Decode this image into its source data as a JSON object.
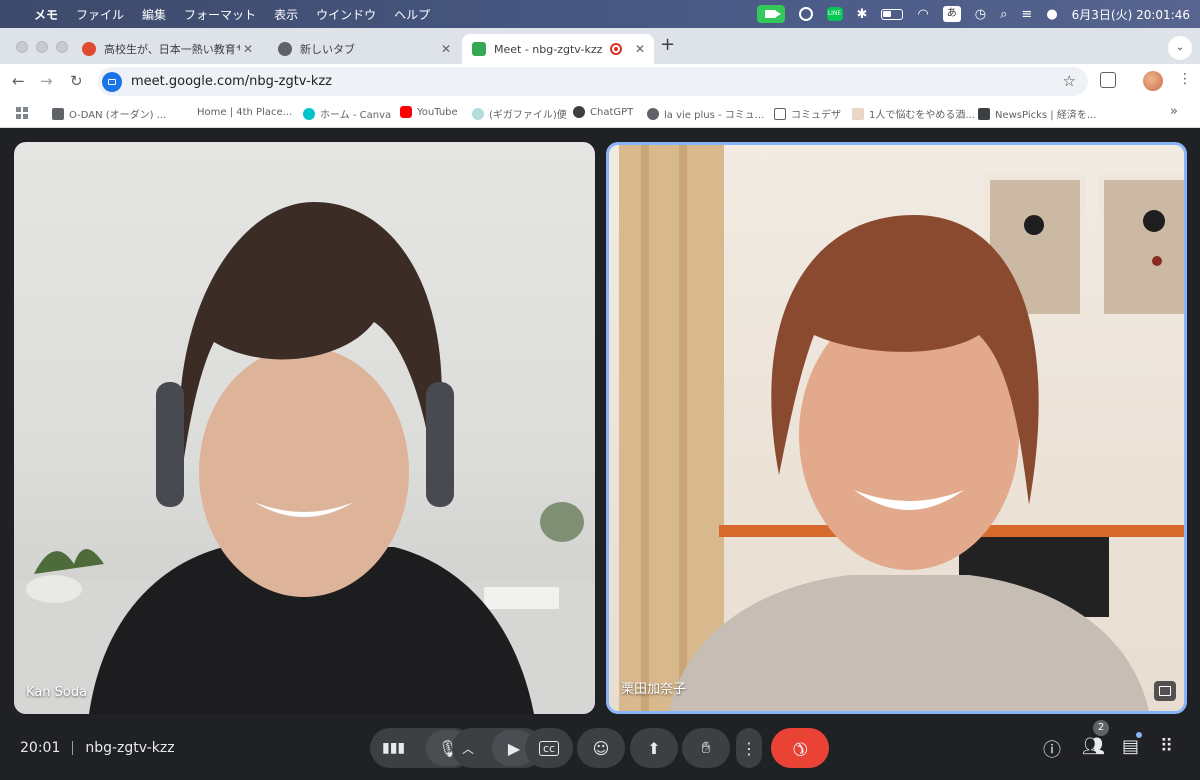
{
  "menubar": {
    "app_name": "メモ",
    "items": [
      "ファイル",
      "編集",
      "フォーマット",
      "表示",
      "ウインドウ",
      "ヘルプ"
    ],
    "clock": "6月3日(火)  20:01:46",
    "input_mode": "あ",
    "line_label": "LINE"
  },
  "tabs": [
    {
      "title": "高校生が、日本一熱い教育サミッ",
      "favicon_color": "#e04a2f"
    },
    {
      "title": "新しいタブ",
      "favicon_color": "#5f6368"
    },
    {
      "title": "Meet - nbg-zgtv-kzz",
      "favicon_color": "#34a853"
    }
  ],
  "address": {
    "url": "meet.google.com/nbg-zgtv-kzz"
  },
  "bookmarks": [
    {
      "label": "O-DAN (オーダン) ...",
      "color": "#5f6368"
    },
    {
      "label": "Home | 4th Place...",
      "color": "#ffffff"
    },
    {
      "label": "ホーム - Canva",
      "color": "#00c4cc"
    },
    {
      "label": "YouTube",
      "color": "#ff0000"
    },
    {
      "label": "(ギガファイル)便",
      "color": "#b2dfdb"
    },
    {
      "label": "ChatGPT",
      "color": "#3c4043"
    },
    {
      "label": "la vie plus - コミュ...",
      "color": "#5f6368"
    },
    {
      "label": "コミュデザ",
      "color": "#5f6368"
    },
    {
      "label": "1人で悩むをやめる酒...",
      "color": "#e8d5c4"
    },
    {
      "label": "NewsPicks | 経済を...",
      "color": "#3c4043"
    }
  ],
  "participants": [
    {
      "name": "Kan Soda"
    },
    {
      "name": "栗田加奈子"
    }
  ],
  "meeting": {
    "time": "20:01",
    "code": "nbg-zgtv-kzz",
    "people_count": "2"
  },
  "colors": {
    "hangup": "#ea4335",
    "control_bg": "#3c4043",
    "active_speaker_border": "#8ab4f8",
    "facetime": "#34c759"
  },
  "icons": [
    "apple-icon",
    "facetime-icon",
    "line-icon",
    "bluetooth-icon",
    "battery-icon",
    "wifi-icon",
    "search-icon",
    "mic-icon",
    "camera-icon",
    "captions-icon",
    "emoji-icon",
    "present-icon",
    "raise-hand-icon",
    "more-icon",
    "hangup-icon",
    "info-icon",
    "people-icon",
    "chat-icon",
    "activities-icon"
  ]
}
